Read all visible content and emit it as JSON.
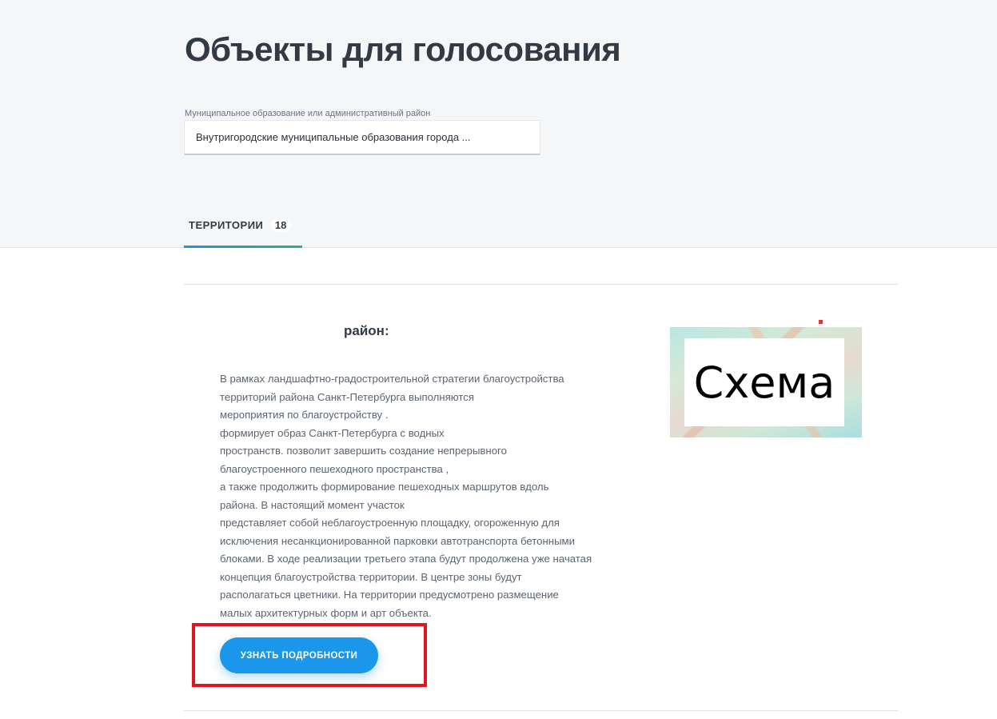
{
  "header": {
    "title": "Объекты для голосования"
  },
  "filter": {
    "label": "Муниципальное образование или административный район",
    "selected": "Внутригородские муниципальные образования города ..."
  },
  "tabs": [
    {
      "label": "ТЕРРИТОРИИ",
      "count": "18"
    }
  ],
  "card": {
    "title": "район:",
    "description": "В рамках ландшафтно-градостроительной стратегии благоустройства\nтерриторий района Санкт-Петербурга выполняются\nмероприятия по благоустройству .\nформирует образ Санкт-Петербурга с водных\nпространств. позволит завершить создание непрерывного\nблагоустроенного пешеходного пространства ,\nа также продолжить формирование пешеходных маршрутов вдоль\nрайона. В настоящий момент участок\nпредставляет собой неблагоустроенную площадку, огороженную для\nисключения несанкционированной парковки автотранспорта бетонными\nблоками. В ходе реализации третьего этапа будут продолжена уже начатая\nконцепция благоустройства территории. В центре зоны будут\nрасполагаться цветники. На территории предусмотрено размещение\nмалых архитектурных форм и арт объекта.",
    "image_caption": "Схема",
    "button_label": "УЗНАТЬ ПОДРОБНОСТИ"
  },
  "colors": {
    "accent": "#1a96ea",
    "highlight": "#e0161f",
    "tab_gradient_start": "#2b8fd8",
    "tab_gradient_end": "#2fb36a"
  }
}
